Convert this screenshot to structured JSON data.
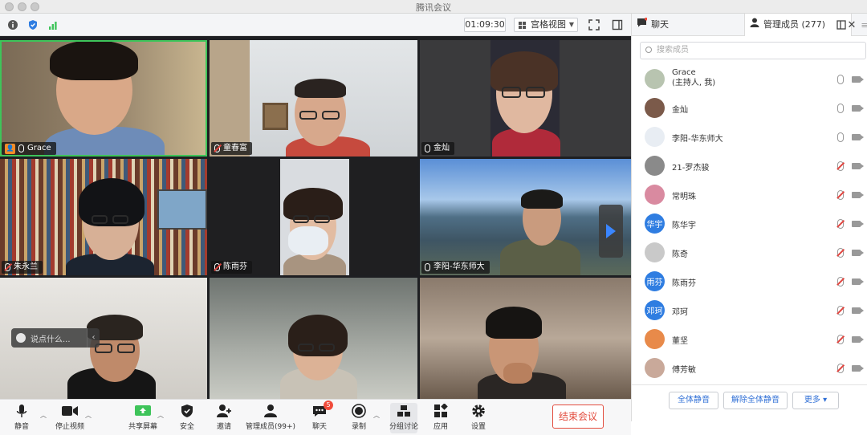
{
  "window": {
    "title": "腾讯会议"
  },
  "topbar": {
    "timer": "01:09:30",
    "view_mode": "宫格视图"
  },
  "tiles": [
    {
      "name": "Grace",
      "mic": "on",
      "host": true,
      "active": true
    },
    {
      "name": "童春富",
      "mic": "off"
    },
    {
      "name": "金灿",
      "mic": "on"
    },
    {
      "name": "朱永兰",
      "mic": "off"
    },
    {
      "name": "陈雨芬",
      "mic": "off"
    },
    {
      "name": "李阳-华东师大",
      "mic": "on"
    },
    {
      "name": "",
      "mic": "off"
    },
    {
      "name": "",
      "mic": "off"
    },
    {
      "name": "",
      "mic": "off"
    }
  ],
  "chat_popup": {
    "placeholder": "说点什么..."
  },
  "toolbar": {
    "mute": "静音",
    "stop_video": "停止视频",
    "share_screen": "共享屏幕",
    "security": "安全",
    "invite": "邀请",
    "manage_members": "管理成员(99+)",
    "chat": "聊天",
    "chat_badge": "5",
    "record": "录制",
    "breakout": "分组讨论",
    "apps": "应用",
    "settings": "设置",
    "end_meeting": "结束会议"
  },
  "panel": {
    "tab_chat": "聊天",
    "tab_members": "管理成员 (277)",
    "search_placeholder": "搜索成员",
    "members": [
      {
        "name": "Grace",
        "sub": "(主持人, 我)",
        "mic": "on",
        "avatar_color": "#b8c4b0",
        "avatar_text": ""
      },
      {
        "name": "金灿",
        "mic": "on",
        "avatar_color": "#7b5a4a",
        "avatar_text": ""
      },
      {
        "name": "李阳-华东师大",
        "mic": "on",
        "avatar_color": "#e8edf3",
        "avatar_text": ""
      },
      {
        "name": "21-罗杰骏",
        "mic": "off",
        "avatar_color": "#8a8a8a",
        "avatar_text": ""
      },
      {
        "name": "常明珠",
        "mic": "off",
        "avatar_color": "#d98aa0",
        "avatar_text": ""
      },
      {
        "name": "陈华宇",
        "mic": "off",
        "avatar_color": "#2f7de1",
        "avatar_text": "华宇"
      },
      {
        "name": "陈奇",
        "mic": "off",
        "avatar_color": "#c9c9c9",
        "avatar_text": ""
      },
      {
        "name": "陈雨芬",
        "mic": "off",
        "avatar_color": "#2f7de1",
        "avatar_text": "雨芬"
      },
      {
        "name": "邓珂",
        "mic": "off",
        "avatar_color": "#2f7de1",
        "avatar_text": "邓珂"
      },
      {
        "name": "董坚",
        "mic": "off",
        "avatar_color": "#e88a4a",
        "avatar_text": ""
      },
      {
        "name": "傅芳敏",
        "mic": "off",
        "avatar_color": "#c9a99a",
        "avatar_text": ""
      }
    ],
    "mute_all": "全体静音",
    "unmute_all": "解除全体静音",
    "more": "更多"
  },
  "colors": {
    "accent": "#2f7de1",
    "danger": "#e34c3e",
    "active_speaker": "#3ec45a"
  }
}
